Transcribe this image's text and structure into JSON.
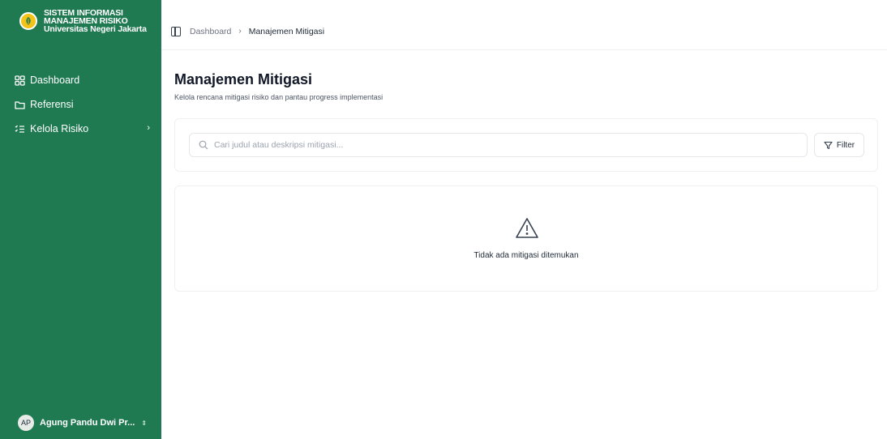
{
  "sidebar": {
    "brand": {
      "line1": "SISTEM INFORMASI",
      "line2": "MANAJEMEN RISIKO",
      "line3": "Universitas Negeri Jakarta"
    },
    "items": [
      {
        "label": "Dashboard",
        "icon": "dashboard-grid-icon"
      },
      {
        "label": "Referensi",
        "icon": "folder-icon"
      },
      {
        "label": "Kelola Risiko",
        "icon": "list-icon",
        "has_submenu": true
      }
    ],
    "user": {
      "initials": "AP",
      "name": "Agung Pandu Dwi Pr..."
    }
  },
  "breadcrumb": {
    "items": [
      "Dashboard",
      "Manajemen Mitigasi"
    ]
  },
  "page": {
    "title": "Manajemen Mitigasi",
    "subtitle": "Kelola rencana mitigasi risiko dan pantau progress implementasi"
  },
  "search": {
    "placeholder": "Cari judul atau deskripsi mitigasi...",
    "value": ""
  },
  "filter": {
    "label": "Filter"
  },
  "empty_state": {
    "message": "Tidak ada mitigasi ditemukan",
    "icon": "warning-triangle-icon"
  },
  "colors": {
    "sidebar": "#1f7a52",
    "logo": "#f3c318"
  }
}
